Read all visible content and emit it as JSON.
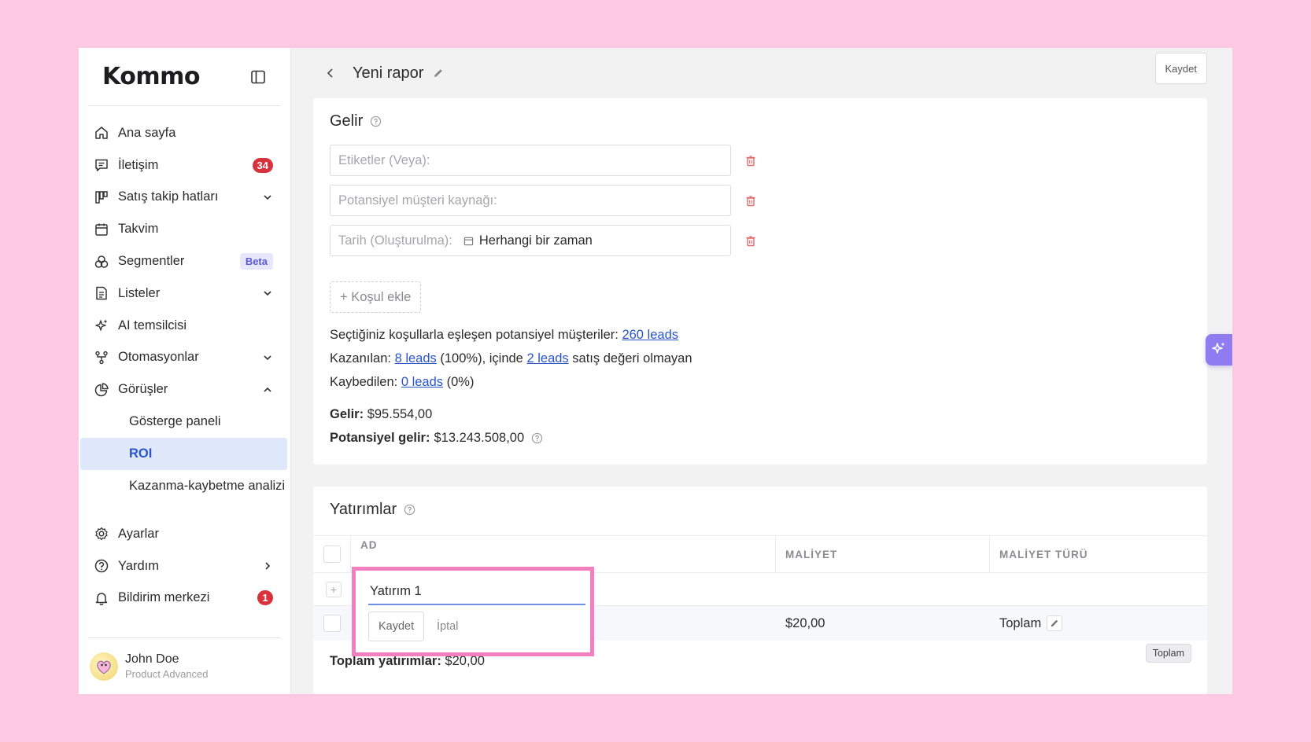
{
  "app": {
    "logo": "Kommo"
  },
  "sidebar": {
    "items": [
      {
        "label": "Ana sayfa",
        "icon": "home-icon"
      },
      {
        "label": "İletişim",
        "icon": "chat-icon",
        "badge": "34"
      },
      {
        "label": "Satış takip hatları",
        "icon": "pipeline-icon"
      },
      {
        "label": "Takvim",
        "icon": "calendar-icon"
      },
      {
        "label": "Segmentler",
        "icon": "segments-icon",
        "badge": "Beta"
      },
      {
        "label": "Listeler",
        "icon": "list-icon"
      },
      {
        "label": "AI temsilcisi",
        "icon": "sparkle-icon"
      },
      {
        "label": "Otomasyonlar",
        "icon": "automation-icon"
      },
      {
        "label": "Görüşler",
        "icon": "pie-chart-icon"
      }
    ],
    "sub_items": [
      {
        "label": "Gösterge paneli"
      },
      {
        "label": "ROI"
      },
      {
        "label": "Kazanma-kaybetme analizi"
      }
    ],
    "bottom_items": [
      {
        "label": "Ayarlar",
        "icon": "gear-icon"
      },
      {
        "label": "Yardım",
        "icon": "help-icon"
      },
      {
        "label": "Bildirim merkezi",
        "icon": "bell-icon",
        "badge": "1"
      }
    ],
    "user": {
      "name": "John Doe",
      "plan": "Product Advanced"
    }
  },
  "header": {
    "title": "Yeni rapor",
    "save_label": "Kaydet"
  },
  "income": {
    "title": "Gelir",
    "filters": [
      {
        "placeholder": "Etiketler (Veya):"
      },
      {
        "placeholder": "Potansiyel müşteri kaynağı:"
      },
      {
        "placeholder": "Tarih (Oluşturulma):",
        "value": "Herhangi bir zaman"
      }
    ],
    "add_condition": "+ Koşul ekle",
    "matched_text": "Seçtiğiniz koşullarla eşleşen potansiyel müşteriler:",
    "matched_link": "260 leads",
    "won_text": "Kazanılan:",
    "won_link": "8 leads",
    "won_pct": "(100%), içinde",
    "won_no_value_link": "2 leads",
    "won_suffix": "satış değeri olmayan",
    "lost_text": "Kaybedilen:",
    "lost_link": "0 leads",
    "lost_pct": "(0%)",
    "revenue_label": "Gelir:",
    "revenue_value": "$95.554,00",
    "potential_label": "Potansiyel gelir:",
    "potential_value": "$13.243.508,00"
  },
  "investments": {
    "title": "Yatırımlar",
    "columns": [
      "AD",
      "MALİYET",
      "MALİYET TÜRÜ"
    ],
    "row": {
      "cost": "$20,00",
      "type": "Toplam"
    },
    "total_label": "Toplam yatırımlar:",
    "total_value": "$20,00",
    "tooltip": "Toplam",
    "editor": {
      "value": "Yatırım 1",
      "save": "Kaydet",
      "cancel": "İptal"
    }
  }
}
